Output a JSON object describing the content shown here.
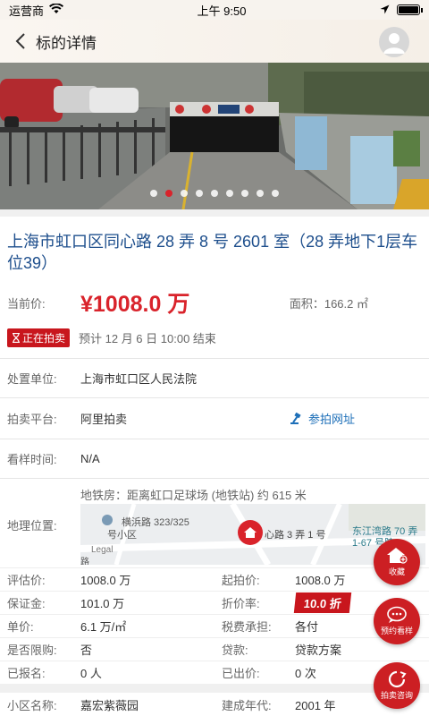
{
  "status": {
    "carrier": "运营商",
    "time": "上午 9:50"
  },
  "nav": {
    "title": "标的详情"
  },
  "banner": {
    "dot_count": 9,
    "active_index": 1
  },
  "detail": {
    "title": "上海市虹口区同心路 28 弄 8 号 2601 室（28 弄地下1层车位39）",
    "price_label": "当前价:",
    "price": "¥1008.0 万",
    "area": "面积：166.2 ㎡",
    "status_tag": "正在拍卖",
    "end_time": "预计 12 月 6 日 10:00 结束"
  },
  "info": {
    "court_label": "处置单位:",
    "court": "上海市虹口区人民法院",
    "platform_label": "拍卖平台:",
    "platform": "阿里拍卖",
    "platform_link": "参拍网址",
    "viewing_label": "看样时间:",
    "viewing": "N/A",
    "geo_label": "地理位置:",
    "subway": "地铁房：距离虹口足球场 (地铁站) 约 615 米"
  },
  "map": {
    "place1": "横浜路 323/325",
    "place1b": "号小区",
    "place2": "心路 3 弄 1 号",
    "place3": "东江湾路 70 弄",
    "place3b": "1-67 号院",
    "legal": "Legal",
    "road": "路"
  },
  "grid": [
    {
      "label": "评估价:",
      "value": "1008.0 万"
    },
    {
      "label": "起拍价:",
      "value": "1008.0 万"
    },
    {
      "label": "保证金:",
      "value": "101.0 万"
    },
    {
      "label": "折价率:",
      "value": "10.0 折"
    },
    {
      "label": "单价:",
      "value": "6.1 万/㎡"
    },
    {
      "label": "税费承担:",
      "value": "各付"
    },
    {
      "label": "是否限购:",
      "value": "否"
    },
    {
      "label": "贷款:",
      "value": "贷款方案"
    },
    {
      "label": "已报名:",
      "value": "0 人"
    },
    {
      "label": "已出价:",
      "value": "0 次"
    },
    {
      "label": "小区名称:",
      "value": "嘉宏紫薇园"
    },
    {
      "label": "建成年代:",
      "value": "2001 年"
    }
  ],
  "float": {
    "favorite": "收藏",
    "book": "预约看样",
    "consult": "拍卖咨询"
  },
  "colors": {
    "accent_red": "#d9232b",
    "link_blue": "#1d6fb8",
    "title_blue": "#1d4e8c"
  }
}
